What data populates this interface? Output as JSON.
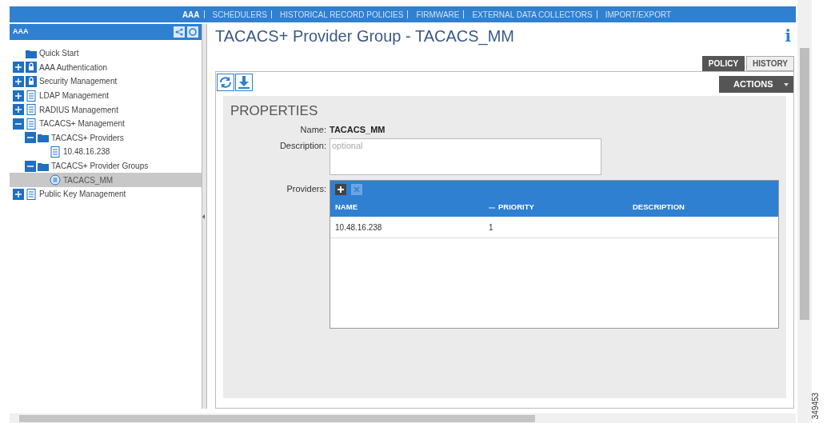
{
  "top_nav": [
    {
      "label": "AAA",
      "selected": true
    },
    {
      "label": "SCHEDULERS",
      "selected": false
    },
    {
      "label": "HISTORICAL RECORD POLICIES",
      "selected": false
    },
    {
      "label": "FIRMWARE",
      "selected": false
    },
    {
      "label": "EXTERNAL DATA COLLECTORS",
      "selected": false
    },
    {
      "label": "IMPORT/EXPORT",
      "selected": false
    }
  ],
  "sidebar": {
    "title": "AAA",
    "items": [
      {
        "label": "Quick Start",
        "kind": "folder",
        "selected": false
      },
      {
        "label": "AAA Authentication",
        "kind": "lock",
        "expanded": false,
        "selected": false
      },
      {
        "label": "Security Management",
        "kind": "lock",
        "expanded": false,
        "selected": false
      },
      {
        "label": "LDAP Management",
        "kind": "document",
        "expanded": false,
        "selected": false
      },
      {
        "label": "RADIUS Management",
        "kind": "document",
        "expanded": false,
        "selected": false
      },
      {
        "label": "TACACS+ Management",
        "kind": "document",
        "expanded": true,
        "selected": false,
        "children": [
          {
            "label": "TACACS+ Providers",
            "kind": "folder",
            "expanded": true,
            "selected": false,
            "children": [
              {
                "label": "10.48.16.238",
                "kind": "document",
                "selected": false
              }
            ]
          },
          {
            "label": "TACACS+ Provider Groups",
            "kind": "folder",
            "expanded": true,
            "selected": false,
            "children": [
              {
                "label": "TACACS_MM",
                "kind": "group",
                "selected": true
              }
            ]
          }
        ]
      },
      {
        "label": "Public Key Management",
        "kind": "document",
        "expanded": false,
        "selected": false
      }
    ]
  },
  "page": {
    "title": "TACACS+ Provider Group - TACACS_MM",
    "info": "i",
    "tabs": [
      {
        "label": "POLICY",
        "selected": true
      },
      {
        "label": "HISTORY",
        "selected": false
      }
    ],
    "actions": "ACTIONS",
    "properties": {
      "heading": "PROPERTIES",
      "name_label": "Name:",
      "name_value": "TACACS_MM",
      "description_label": "Description:",
      "description_placeholder": "optional",
      "providers_label": "Providers:",
      "table": {
        "columns": [
          {
            "label": "NAME",
            "sorted": false
          },
          {
            "label": "PRIORITY",
            "sorted": true
          },
          {
            "label": "DESCRIPTION",
            "sorted": false
          }
        ],
        "rows": [
          {
            "name": "10.48.16.238",
            "priority": "1"
          }
        ]
      }
    }
  },
  "figure_id": "349453"
}
